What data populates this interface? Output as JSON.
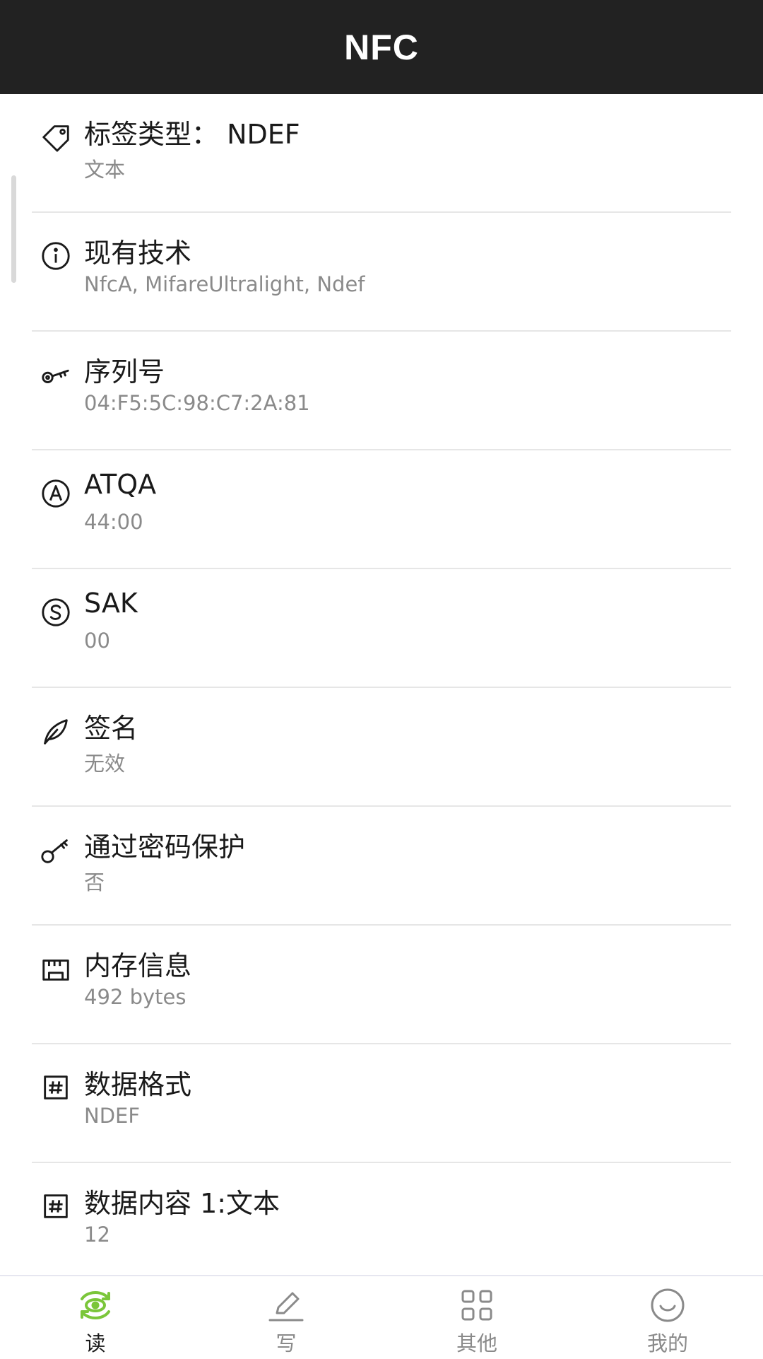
{
  "header": {
    "title": "NFC"
  },
  "items": [
    {
      "icon": "tag-icon",
      "label": "标签类型：  NDEF",
      "value": "文本"
    },
    {
      "icon": "info-icon",
      "label": "现有技术",
      "value": "NfcA, MifareUltralight, Ndef"
    },
    {
      "icon": "key-icon",
      "label": "序列号",
      "value": "04:F5:5C:98:C7:2A:81"
    },
    {
      "icon": "circle-a-icon",
      "label": "ATQA",
      "value": "44:00"
    },
    {
      "icon": "circle-s-icon",
      "label": "SAK",
      "value": "00"
    },
    {
      "icon": "feather-icon",
      "label": "签名",
      "value": "无效"
    },
    {
      "icon": "password-key-icon",
      "label": "通过密码保护",
      "value": "否"
    },
    {
      "icon": "memory-icon",
      "label": "内存信息",
      "value": "492 bytes"
    },
    {
      "icon": "hash-box-icon",
      "label": "数据格式",
      "value": "NDEF"
    },
    {
      "icon": "hash-box-icon",
      "label": "数据内容 1:文本",
      "value": "12"
    }
  ],
  "bottom_nav": {
    "active_index": 0,
    "active_color": "#7bc63a",
    "items": [
      {
        "icon": "read-eye-icon",
        "label": "读"
      },
      {
        "icon": "pencil-icon",
        "label": "写"
      },
      {
        "icon": "grid-icon",
        "label": "其他"
      },
      {
        "icon": "smile-icon",
        "label": "我的"
      }
    ]
  }
}
